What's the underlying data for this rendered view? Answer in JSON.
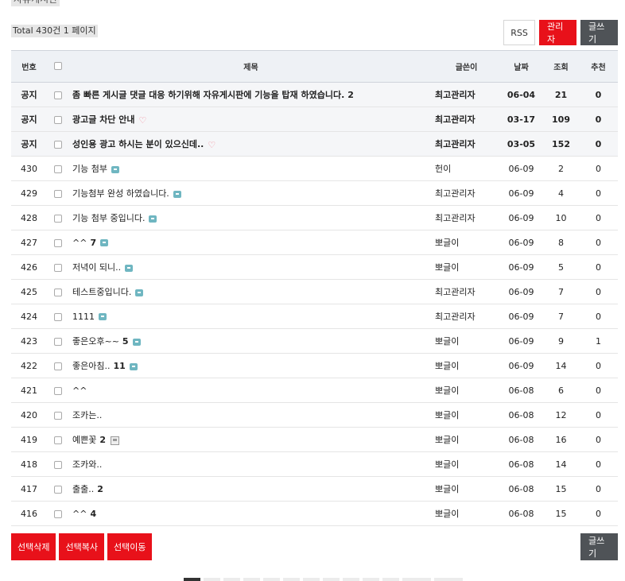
{
  "board": {
    "title": "자유게시판",
    "total_text": "Total 430건 1 페이지"
  },
  "top_buttons": {
    "rss": "RSS",
    "admin": "관리자",
    "write": "글쓰기"
  },
  "table": {
    "headers": {
      "num": "번호",
      "subject": "제목",
      "writer": "글쓴이",
      "date": "날짜",
      "hit": "조회",
      "good": "추천"
    },
    "rows": [
      {
        "num": "공지",
        "subject": "좀 빠른 게시글 댓글 대응 하기위해 자유게시판에 기능을 탑재 하였습니다.",
        "comments": "2",
        "icon": "",
        "writer": "최고관리자",
        "date": "06-04",
        "hit": "21",
        "good": "0",
        "notice": true
      },
      {
        "num": "공지",
        "subject": "광고글 차단 안내",
        "comments": "",
        "icon": "heart-icon",
        "writer": "최고관리자",
        "date": "03-17",
        "hit": "109",
        "good": "0",
        "notice": true
      },
      {
        "num": "공지",
        "subject": "성인용 광고 하시는 분이 있으신데..",
        "comments": "",
        "icon": "heart-icon",
        "writer": "최고관리자",
        "date": "03-05",
        "hit": "152",
        "good": "0",
        "notice": true
      },
      {
        "num": "430",
        "subject": "기능 첨부",
        "comments": "",
        "icon": "comment-icon",
        "writer": "헌이",
        "date": "06-09",
        "hit": "2",
        "good": "0",
        "notice": false
      },
      {
        "num": "429",
        "subject": "기능첨부 완성 하였습니다.",
        "comments": "",
        "icon": "comment-icon",
        "writer": "최고관리자",
        "date": "06-09",
        "hit": "4",
        "good": "0",
        "notice": false
      },
      {
        "num": "428",
        "subject": "기능 첨부 중입니다.",
        "comments": "",
        "icon": "comment-icon",
        "writer": "최고관리자",
        "date": "06-09",
        "hit": "10",
        "good": "0",
        "notice": false
      },
      {
        "num": "427",
        "subject": "^^",
        "comments": "7",
        "icon": "comment-icon",
        "writer": "뽀글이",
        "date": "06-09",
        "hit": "8",
        "good": "0",
        "notice": false
      },
      {
        "num": "426",
        "subject": "저녁이 되니..",
        "comments": "",
        "icon": "comment-icon",
        "writer": "뽀글이",
        "date": "06-09",
        "hit": "5",
        "good": "0",
        "notice": false
      },
      {
        "num": "425",
        "subject": "테스트중입니다.",
        "comments": "",
        "icon": "comment-icon",
        "writer": "최고관리자",
        "date": "06-09",
        "hit": "7",
        "good": "0",
        "notice": false
      },
      {
        "num": "424",
        "subject": "1111",
        "comments": "",
        "icon": "comment-icon",
        "writer": "최고관리자",
        "date": "06-09",
        "hit": "7",
        "good": "0",
        "notice": false
      },
      {
        "num": "423",
        "subject": "좋은오후~~",
        "comments": "5",
        "icon": "comment-icon",
        "writer": "뽀글이",
        "date": "06-09",
        "hit": "9",
        "good": "1",
        "notice": false
      },
      {
        "num": "422",
        "subject": "좋은아침..",
        "comments": "11",
        "icon": "comment-icon",
        "writer": "뽀글이",
        "date": "06-09",
        "hit": "14",
        "good": "0",
        "notice": false
      },
      {
        "num": "421",
        "subject": "^^",
        "comments": "",
        "icon": "",
        "writer": "뽀글이",
        "date": "06-08",
        "hit": "6",
        "good": "0",
        "notice": false
      },
      {
        "num": "420",
        "subject": "조카는..",
        "comments": "",
        "icon": "",
        "writer": "뽀글이",
        "date": "06-08",
        "hit": "12",
        "good": "0",
        "notice": false
      },
      {
        "num": "419",
        "subject": "예쁜꽃",
        "comments": "2",
        "icon": "file-icon",
        "writer": "뽀글이",
        "date": "06-08",
        "hit": "16",
        "good": "0",
        "notice": false
      },
      {
        "num": "418",
        "subject": "조카와..",
        "comments": "",
        "icon": "",
        "writer": "뽀글이",
        "date": "06-08",
        "hit": "14",
        "good": "0",
        "notice": false
      },
      {
        "num": "417",
        "subject": "출출..",
        "comments": "2",
        "icon": "",
        "writer": "뽀글이",
        "date": "06-08",
        "hit": "15",
        "good": "0",
        "notice": false
      },
      {
        "num": "416",
        "subject": "^^",
        "comments": "4",
        "icon": "",
        "writer": "뽀글이",
        "date": "06-08",
        "hit": "15",
        "good": "0",
        "notice": false
      }
    ]
  },
  "bottom_buttons": {
    "delete": "선택삭제",
    "copy": "선택복사",
    "move": "선택이동",
    "write": "글쓰기"
  },
  "pagination": {
    "current_index": 0,
    "count": 13
  },
  "colors": {
    "accent_red": "#e8111a",
    "dark_button": "#4f5357",
    "header_bg": "#eef1f5",
    "notice_bg": "#f5f6f8",
    "comment_icon": "#6fb6c1",
    "heart_icon": "#f28b9a"
  }
}
